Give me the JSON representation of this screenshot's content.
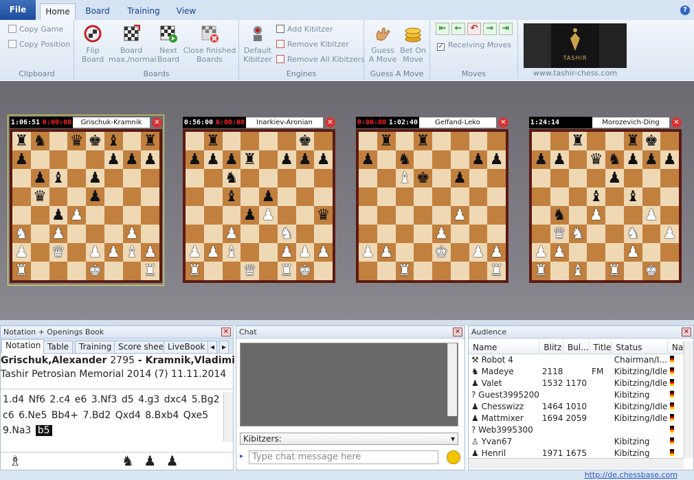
{
  "ribbon": {
    "tabs": [
      "File",
      "Home",
      "Board",
      "Training",
      "View"
    ],
    "help": "?",
    "clipboard": {
      "copy_game": "Copy Game",
      "copy_position": "Copy Position",
      "label": "Clipboard"
    },
    "boards": {
      "flip": [
        "Flip",
        "Board"
      ],
      "max": [
        "Board",
        "max./normal"
      ],
      "next": [
        "Next",
        "Board"
      ],
      "close": [
        "Close finished",
        "Boards"
      ],
      "label": "Boards"
    },
    "engines": {
      "default": [
        "Default",
        "Kibitzer"
      ],
      "add": "Add Kibitzer",
      "remove": "Remove Kibitzer",
      "remove_all": "Remove All Kibitzers",
      "label": "Engines"
    },
    "guess": {
      "guess": [
        "Guess",
        "A Move"
      ],
      "bet": [
        "Bet On",
        "Move"
      ],
      "label": "Guess A Move"
    },
    "moves": {
      "receiving": "Receiving Moves",
      "label": "Moves"
    },
    "ad_url": "www.tashir-chess.com",
    "ad_text": "TASHIR"
  },
  "games": [
    {
      "name": "Grischuk-Kramnik",
      "clock_white": "1:06:51",
      "clock_black": "0:00:00",
      "selected": true,
      "fen": "rn1qkb1r/p4ppp/1pb1p3/1q2p3/2pP4/N1P3P1/P1Q1PPBP/R3K2R"
    },
    {
      "name": "Inarkiev-Aronian",
      "clock_white": "0:56:00",
      "clock_black": "0:00:00",
      "selected": false,
      "fen": "1r4k1/pppr1ppp/2n5/2b1p3/3pP2q/2P2N2/PPB2PPP/R2Q1RK1"
    },
    {
      "name": "Gelfand-Leko",
      "clock_white": "0:00:00",
      "clock_black": "1:02:40",
      "selected": false,
      "fen": "1r1r4/p1n3pp/2Bk1p2/8/5P2/4P3/PP2K1PP/2R4R"
    },
    {
      "name": "Morozevich-Ding",
      "clock_white": "1:24:14",
      "clock_black": "",
      "selected": false,
      "fen": "2r2rk1/pp1qnppp/4p3/3b1b2/1n1P2P1/1QN2N1P/PP3P2/R1B1R1K1"
    }
  ],
  "notation": {
    "title": "Notation + Openings Book",
    "tabs": [
      "Notation",
      "Table",
      "Training",
      "Score sheet",
      "LiveBook"
    ],
    "white": "Grischuk,Alexander",
    "white_elo": "2795",
    "sep": "-",
    "black": "Kramnik,Vladimir",
    "event": "Tashir Petrosian Memorial 2014 (7) 11.11.2014",
    "moves": [
      "1.d4",
      "Nf6",
      "2.c4",
      "e6",
      "3.Nf3",
      "d5",
      "4.g3",
      "dxc4",
      "5.Bg2",
      "c6",
      "6.Ne5",
      "Bb4+",
      "7.Bd2",
      "Qxd4",
      "8.Bxb4",
      "Qxe5",
      "9.Na3",
      "b5"
    ],
    "current": 17,
    "captured_white": "♗",
    "captured_black": "♞ ♟ ♟"
  },
  "chat": {
    "title": "Chat",
    "kibitzers": "Kibitzers:",
    "placeholder": "Type chat message here"
  },
  "audience": {
    "title": "Audience",
    "columns": [
      "Name",
      "Blitz",
      "Bul...",
      "Title",
      "Status",
      "Na"
    ],
    "rows": [
      {
        "icon": "⚒",
        "name": "Robot 4",
        "blitz": "",
        "bullet": "",
        "title": "",
        "status": "Chairman/I..."
      },
      {
        "icon": "♞",
        "name": "Madeye",
        "blitz": "2118",
        "bullet": "",
        "title": "FM",
        "status": "Kibitzing/Idle"
      },
      {
        "icon": "♟",
        "name": "Valet",
        "blitz": "1532",
        "bullet": "1170",
        "title": "",
        "status": "Kibitzing/Idle"
      },
      {
        "icon": "?",
        "name": "Guest3995200",
        "blitz": "",
        "bullet": "",
        "title": "",
        "status": "Kibitzing"
      },
      {
        "icon": "♟",
        "name": "Chesswizz",
        "blitz": "1464",
        "bullet": "1010",
        "title": "",
        "status": "Kibitzing/Idle"
      },
      {
        "icon": "♟",
        "name": "Mattmixer",
        "blitz": "1694",
        "bullet": "2059",
        "title": "",
        "status": "Kibitzing/Idle"
      },
      {
        "icon": "?",
        "name": "Web3995300",
        "blitz": "",
        "bullet": "",
        "title": "",
        "status": ""
      },
      {
        "icon": "♙",
        "name": "Yvan67",
        "blitz": "",
        "bullet": "",
        "title": "",
        "status": "Kibitzing"
      },
      {
        "icon": "♟",
        "name": "Henril",
        "blitz": "1971",
        "bullet": "1675",
        "title": "",
        "status": "Kibitzing"
      }
    ]
  },
  "status": {
    "url": "http://de.chessbase.com"
  },
  "colors": {
    "clock_red": "#ff2020",
    "clock_white": "#ffffff",
    "ribbon": "#dfe9f5"
  }
}
